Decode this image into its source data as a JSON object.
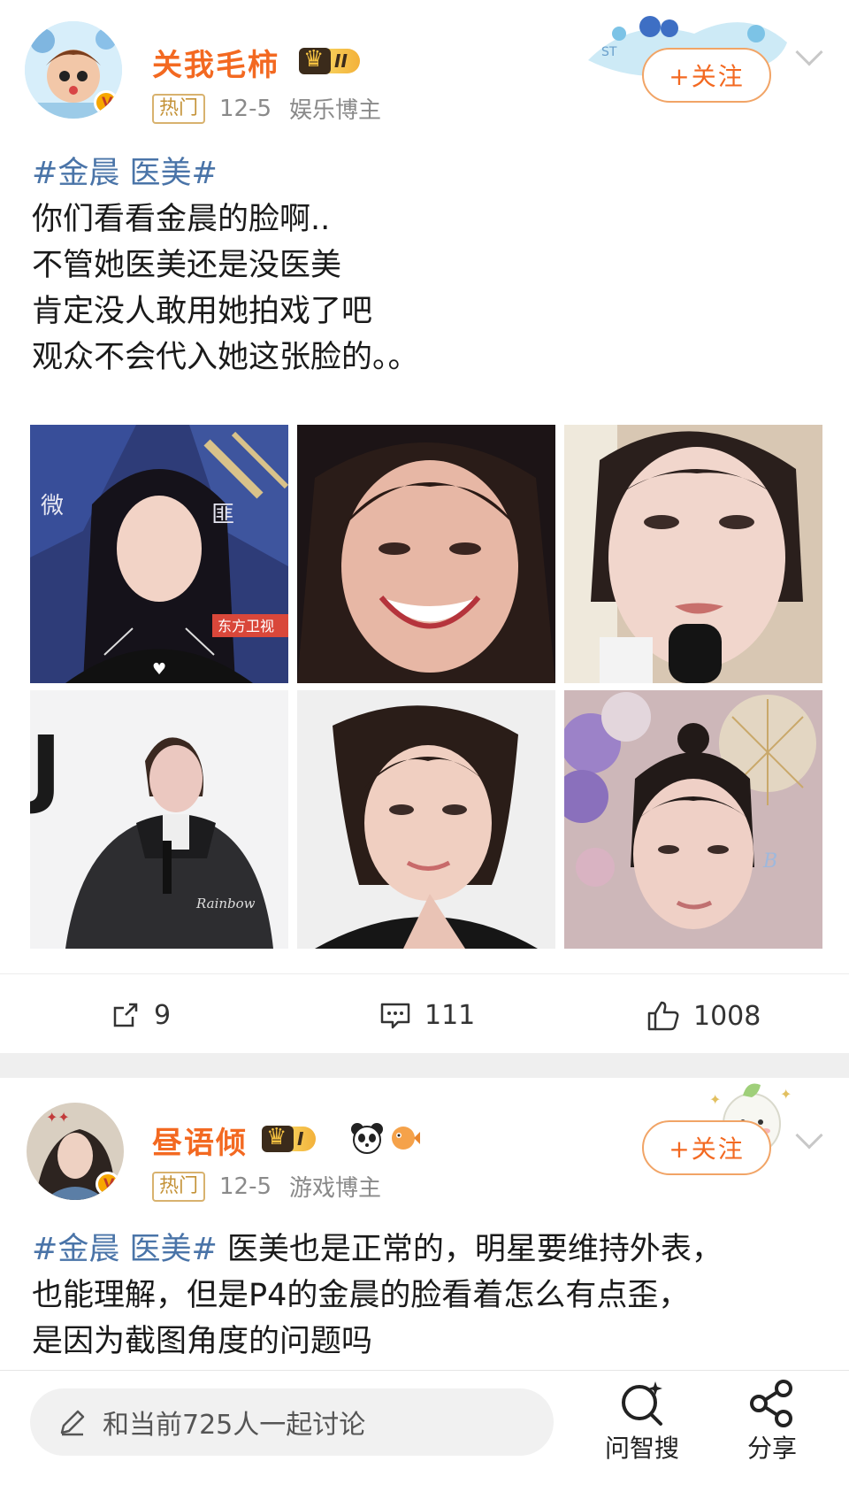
{
  "post1": {
    "username": "关我毛柿",
    "vip_level": "II",
    "hot_tag": "热门",
    "date": "12-5",
    "category": "娱乐博主",
    "follow_label": "+关注",
    "hashtag": "#金晨 医美#",
    "lines": [
      "你们看看金晨的脸啊..",
      "不管她医美还是没医美",
      "肯定没人敢用她拍戏了吧",
      "观众不会代入她这张脸的。。"
    ],
    "photo_texts": {
      "p1_sign": "微",
      "p1_sign2": "匪",
      "p1_banner": "东方卫视",
      "p4_letter": "J",
      "p4_sig": "Rainbow"
    },
    "actions": {
      "repost": "9",
      "comment": "111",
      "like": "1008"
    }
  },
  "post2": {
    "username": "昼语倾",
    "vip_level": "I",
    "hot_tag": "热门",
    "date": "12-5",
    "category": "游戏博主",
    "follow_label": "+关注",
    "hashtag": "#金晨 医美#",
    "text_line1": " 医美也是正常的，明星要维持外表，",
    "text_line2": "也能理解，但是P4的金晨的脸看着怎么有点歪，",
    "text_line3": "是因为截图角度的问题吗"
  },
  "bottom_bar": {
    "comment_placeholder": "和当前725人一起讨论",
    "tool1_label": "问智搜",
    "tool2_label": "分享"
  },
  "icons": {
    "repost": "repost-icon",
    "comment": "comment-icon",
    "like": "like-icon",
    "pencil": "pencil-icon",
    "search": "ai-search-icon",
    "share": "share-icon"
  },
  "colors": {
    "username": "#f36921",
    "hashtag": "#4a74a8",
    "follow_border": "#f1a466"
  }
}
